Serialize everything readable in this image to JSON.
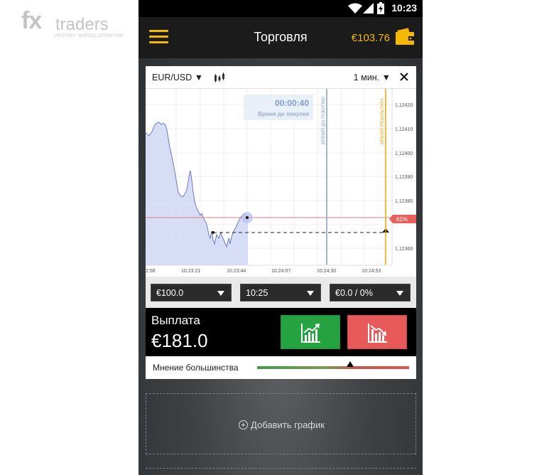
{
  "watermark": {
    "logo_main": "fx",
    "logo_brand": "traders",
    "logo_tagline": "РЕЙТИНГ ФОРЕКС БРОКЕРОВ"
  },
  "status_bar": {
    "time": "10:23"
  },
  "header": {
    "title": "Торговля",
    "balance": "€103.76"
  },
  "chart": {
    "pair": "EUR/USD",
    "timeframe": "1 мин.",
    "countdown": "00:00:40",
    "countdown_label": "Время до покупки",
    "purchase_line_label": "ВРЕМЯ ДО ПОКУПКИ",
    "result_line_label": "ВРЕМЯ РЕЗУЛЬТАТА",
    "percent_badge": "61%",
    "y_ticks": [
      "1,12420",
      "1,12410",
      "1,12400",
      "1,12390",
      "1,12380",
      "1,12360"
    ],
    "x_ticks": [
      "2:58",
      "10:23:21",
      "10:23:44",
      "10:24:07",
      "10:24:30",
      "10:24:53"
    ],
    "colors": {
      "line": "#6a79c9",
      "fill": "#c9d2f2",
      "purchase_line": "#7e9ccc",
      "result_line": "#f0a000",
      "level_line": "#ee7a78"
    }
  },
  "controls": {
    "amount": "€100.0",
    "expiry": "10:25",
    "bonus": "€0.0 / 0%"
  },
  "payout": {
    "label": "Выплата",
    "value": "€181.0"
  },
  "majority": {
    "label": "Мнение большинства",
    "position": 0.61
  },
  "add_chart": {
    "label": "Добавить график"
  }
}
